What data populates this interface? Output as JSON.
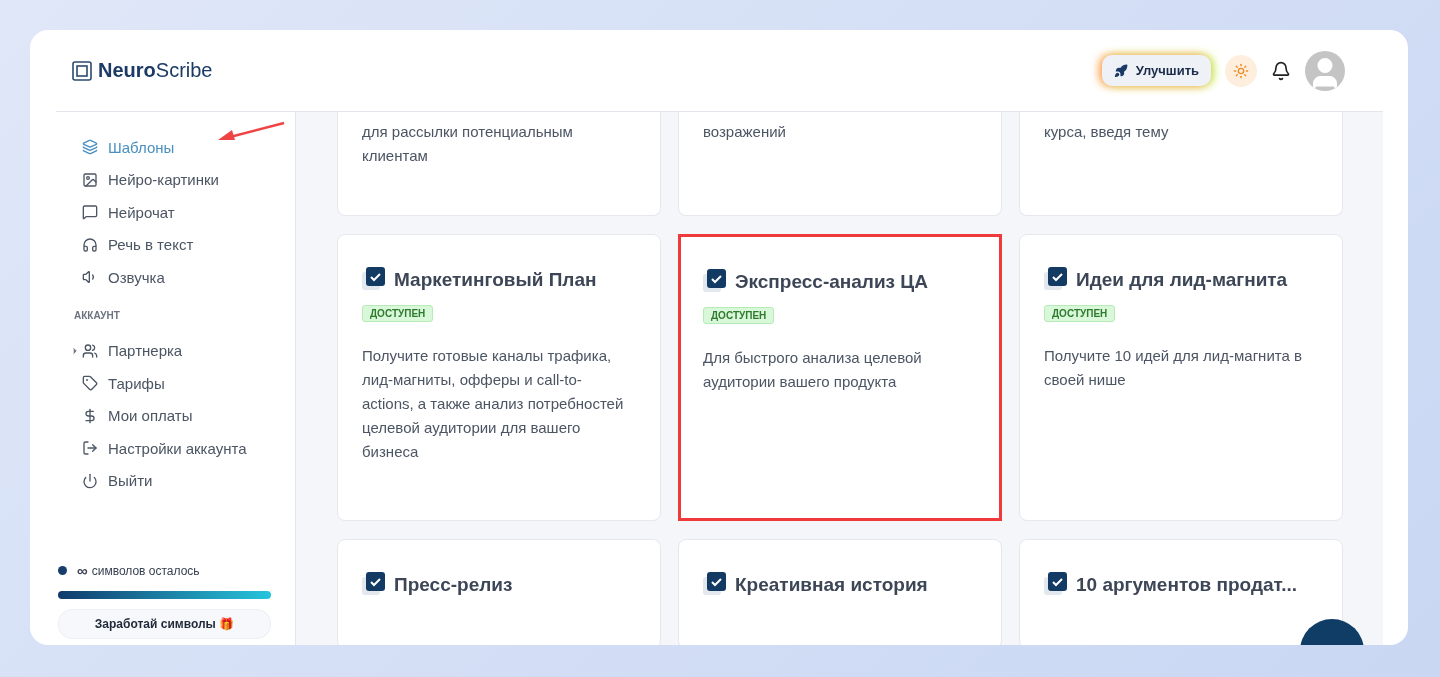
{
  "logo": {
    "text": "**Neuro**Scribe"
  },
  "header": {
    "upgrade_button": "Улучшить"
  },
  "sidebar": {
    "items": [
      {
        "label": "Шаблоны",
        "selected": true
      },
      {
        "label": "Нейро-картинки",
        "selected": false
      },
      {
        "label": "Нейрочат",
        "selected": false
      },
      {
        "label": "Речь в текст",
        "selected": false
      },
      {
        "label": "Озвучка",
        "selected": false
      }
    ],
    "section_title": "АККАУНТ",
    "account_items": [
      {
        "label": "Партнерка",
        "selected": false,
        "expanded": false
      },
      {
        "label": "Тарифы",
        "selected": false
      },
      {
        "label": "Мои оплаты",
        "selected": false
      },
      {
        "label": "Настройки аккаунта",
        "selected": false
      },
      {
        "label": "Выйти",
        "selected": false
      }
    ],
    "symbols": {
      "count": "∞",
      "label": "символов осталось",
      "level": 1
    },
    "earn_button": "Заработай символы 🎁"
  },
  "cards": [
    {
      "description": "для рассылки потенциальным клиентам",
      "highlighted": false
    },
    {
      "description": "возражений",
      "highlighted": false
    },
    {
      "description": "курса, введя тему",
      "highlighted": false
    },
    {
      "title": "Маркетинговый План",
      "badge": "ДОСТУПЕН",
      "description": "Получите готовые каналы трафика, лид-магниты, офферы и call-to-actions, а также анализ потребностей целевой аудитории для вашего бизнеса",
      "highlighted": false
    },
    {
      "title": "Экспресс-анализ ЦА",
      "badge": "ДОСТУПЕН",
      "description": "Для быстрого анализа целевой аудитории вашего продукта",
      "highlighted": true
    },
    {
      "title": "Идеи для лид-магнита",
      "badge": "ДОСТУПЕН",
      "description": "Получите 10 идей для лид-магнита в своей нише",
      "highlighted": false
    },
    {
      "title": "Пресс-релиз",
      "highlighted": false
    },
    {
      "title": "Креативная история",
      "highlighted": false
    },
    {
      "title": "10 аргументов продат...",
      "highlighted": false
    }
  ]
}
